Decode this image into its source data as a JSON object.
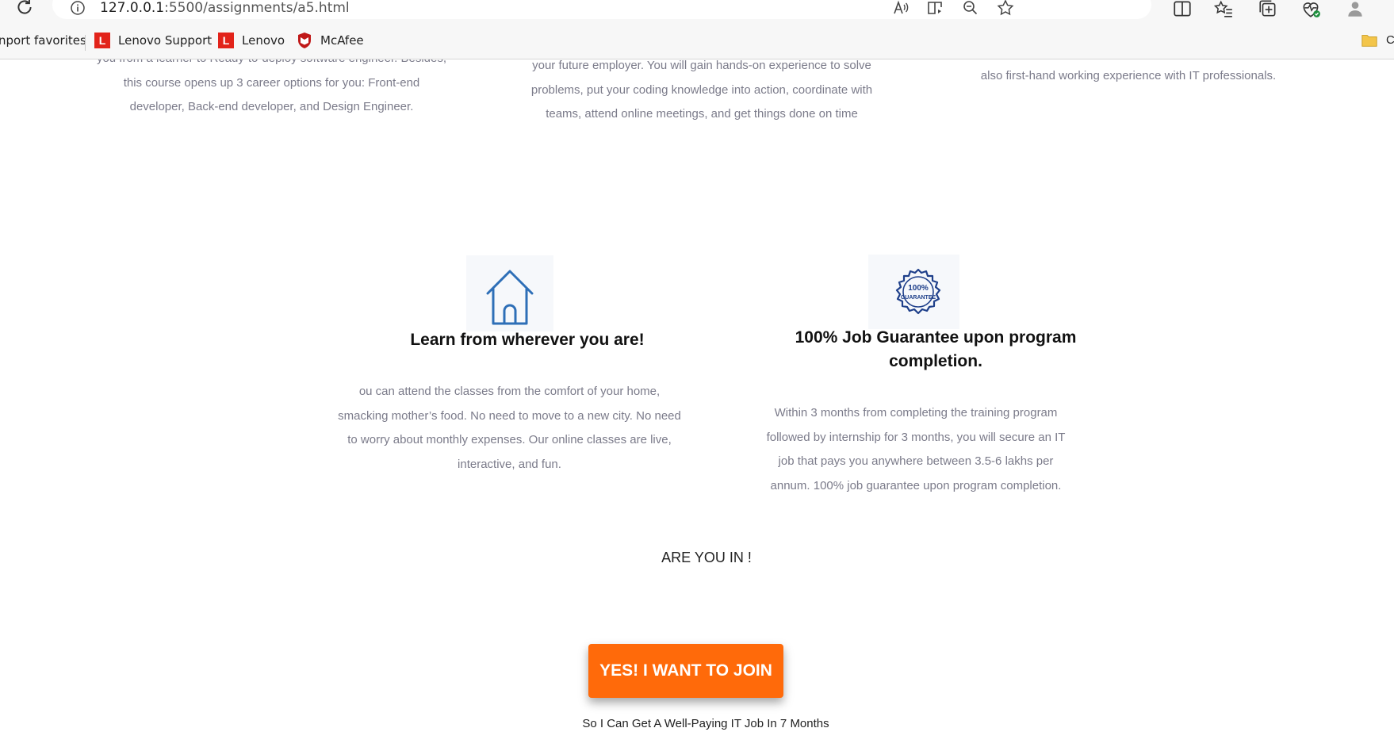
{
  "browser": {
    "url_host": "127.0.0.1",
    "url_rest": ":5500/assignments/a5.html",
    "favorites": [
      {
        "label": "nport favorites"
      },
      {
        "label": "Lenovo Support",
        "badge": "L"
      },
      {
        "label": "Lenovo",
        "badge": "L"
      },
      {
        "label": "McAfee"
      }
    ],
    "favorites_cut": "C"
  },
  "features_top": [
    {
      "text": "you from a learner to Ready-to-deploy software engineer. Besides, this course opens up 3 career options for you: Front-end developer, Back-end developer, and Design Engineer."
    },
    {
      "text": "your future employer. You will gain hands-on experience to solve problems, put your coding knowledge into action, coordinate with teams, attend online meetings, and get things done on time"
    },
    {
      "text": "not only gain “insider information” of the IT industry insights, but also first-hand working experience with IT professionals."
    }
  ],
  "features": [
    {
      "icon": "house-icon",
      "title": "Learn from wherever you are!",
      "text": "ou can attend the classes from the comfort of your home, smacking mother’s food. No need to move to a new city. No need to worry about monthly expenses. Our online classes are live, interactive, and fun."
    },
    {
      "icon": "guarantee-badge-icon",
      "badge_top": "100%",
      "badge_bottom": "GUARANTEE",
      "title": "100% Job Guarantee upon program completion.",
      "text": "Within 3 months from completing the training program followed by internship for 3 months, you will secure an IT job that pays you anywhere between 3.5-6 lakhs per annum. 100% job guarantee upon program completion."
    }
  ],
  "cta": {
    "prompt": "ARE YOU IN !",
    "button_label": "YES! I WANT TO JOIN",
    "subtext": "So I Can Get A Well-Paying IT Job In 7 Months"
  },
  "colors": {
    "accent": "#ff6a0a",
    "muted_text": "#7b7b8a",
    "icon_blue": "#2e6fb7"
  }
}
